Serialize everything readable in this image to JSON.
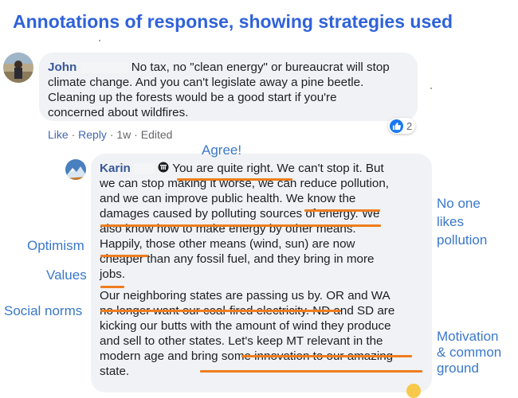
{
  "title": "Annotations of response, showing strategies used",
  "comment1": {
    "author": "John",
    "lines": [
      "No tax, no \"clean energy\" or bureaucrat will stop",
      "climate change. And you can't legislate away a pine beetle.",
      "Cleaning up the forests would be a good start if you're",
      "concerned about wildfires."
    ],
    "actions": {
      "like": "Like",
      "reply": "Reply",
      "time": "1w",
      "edited": "Edited",
      "sep": " · "
    },
    "reaction_count": "2"
  },
  "comment2": {
    "author": "Karin",
    "lines": [
      "You are quite right. We can't stop it. But",
      "we can stop making it worse, we can reduce pollution,",
      "and we can improve public health. We know the",
      "damages caused by polluting sources of energy. We",
      "also know how to make energy by other means.",
      "Happily, those other means (wind, sun) are now",
      "cheaper than any fossil fuel, and they bring in more",
      "jobs.",
      "Our neighboring states are passing us by. OR and WA",
      "no longer want our coal-fired electricity. ND and SD are",
      "kicking our butts with the amount of wind they produce",
      "and sell to other states. Let's keep MT relevant in the",
      "modern age and bring some innovation to our amazing",
      "state."
    ]
  },
  "annotations": {
    "agree": "Agree!",
    "no_one": "No one",
    "likes": "likes",
    "pollution": "pollution",
    "optimism": "Optimism",
    "values": "Values",
    "social_norms": "Social norms",
    "motivation": "Motivation",
    "common": "& common",
    "ground": "ground"
  },
  "colors": {
    "title": "#2f62d9",
    "annotation": "#3a78c9",
    "underline": "#ef7d1e",
    "bubble": "#f0f2f5",
    "author": "#385898"
  },
  "icons": [
    "globe-icon",
    "thumbs-up-icon",
    "emoji-icon"
  ]
}
